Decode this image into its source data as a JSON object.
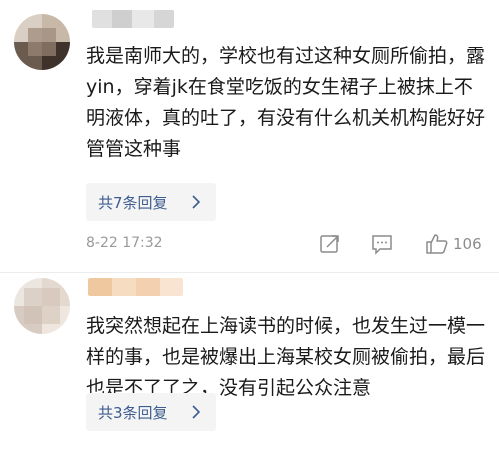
{
  "comments": [
    {
      "text": "我是南师大的，学校也有过这种女厕所偷拍，露yin，穿着jk在食堂吃饭的女生裙子上被抹上不明液体，真的吐了，有没有什么机关机构能好好管管这种事",
      "replies_label": "共7条回复",
      "timestamp": "8-22 17:32",
      "like_count": "106",
      "icons": [
        "share-icon",
        "comment-icon",
        "like-icon"
      ]
    },
    {
      "text": "我突然想起在上海读书的时候，也发生过一模一样的事，也是被爆出上海某校女厕被偷拍，最后也是不了了之，没有引起公众注意",
      "replies_label": "共3条回复"
    }
  ],
  "colors": {
    "reply_link": "#3d5d8f",
    "meta_gray": "#9a9a9a",
    "reply_bg": "#f4f4f4"
  }
}
